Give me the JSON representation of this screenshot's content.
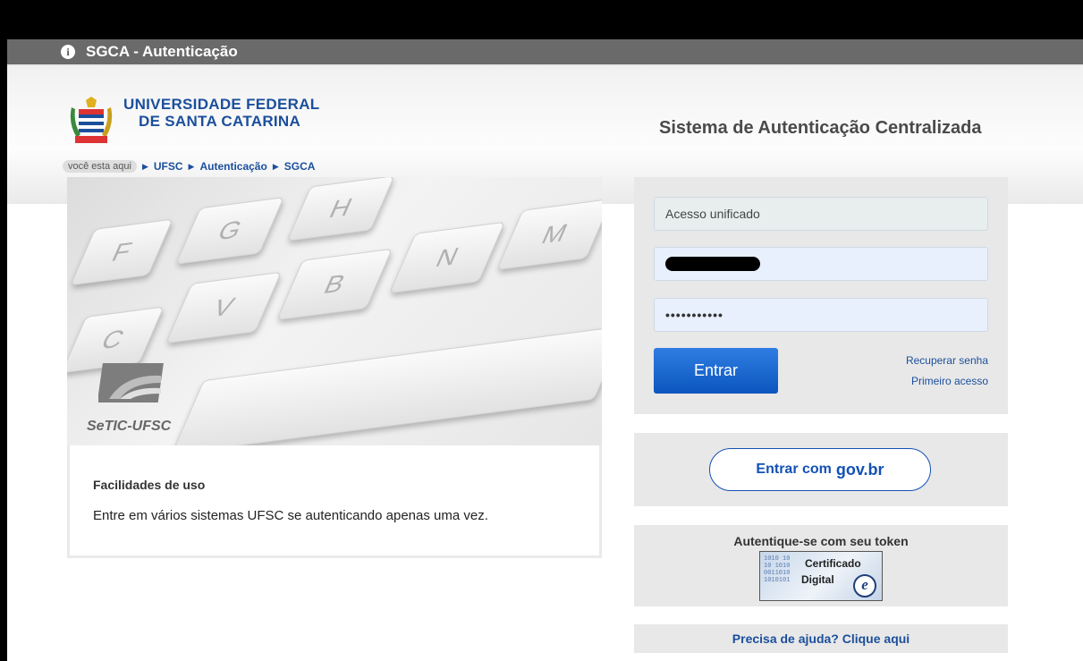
{
  "header": {
    "title": "SGCA - Autenticação"
  },
  "brand": {
    "line1": "UNIVERSIDADE FEDERAL",
    "line2": "DE SANTA CATARINA",
    "system_title": "Sistema de Autenticação Centralizada"
  },
  "breadcrumb": {
    "here_label": "você esta aqui",
    "items": [
      "UFSC",
      "Autenticação",
      "SGCA"
    ]
  },
  "banner": {
    "keys": [
      "F",
      "G",
      "H",
      "C",
      "V",
      "B",
      "N",
      "M"
    ],
    "setic_label": "SeTIC-UFSC"
  },
  "info": {
    "heading": "Facilidades de uso",
    "text": "Entre em vários sistemas UFSC se autenticando apenas uma vez."
  },
  "login": {
    "unified_label": "Acesso unificado",
    "password_mask": "•••••••••••",
    "submit_label": "Entrar",
    "recover_link": "Recuperar senha",
    "first_access_link": "Primeiro acesso"
  },
  "gov": {
    "prefix": "Entrar com",
    "brand": "gov.br"
  },
  "token": {
    "title": "Autentique-se com seu token",
    "cert_line1": "Certificado",
    "cert_line2": "Digital",
    "cert_mark": "e"
  },
  "help": {
    "link": "Precisa de ajuda? Clique aqui"
  },
  "colors": {
    "link_blue": "#1b4f9c",
    "button_blue": "#0a56be",
    "gov_blue": "#1351b4",
    "topbar": "#6a6a6a"
  }
}
